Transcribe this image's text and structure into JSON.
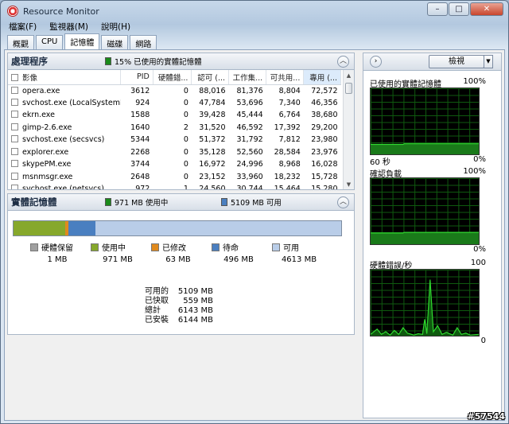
{
  "window": {
    "title": "Resource Monitor",
    "controls": [
      "–",
      "□",
      "✕"
    ]
  },
  "menu": [
    "檔案(F)",
    "監視器(M)",
    "說明(H)"
  ],
  "tabs": [
    {
      "label": "概觀",
      "active": false
    },
    {
      "label": "CPU",
      "active": false
    },
    {
      "label": "記憶體",
      "active": true
    },
    {
      "label": "磁碟",
      "active": false
    },
    {
      "label": "網路",
      "active": false
    }
  ],
  "processes": {
    "title": "處理程序",
    "summary": "15% 已使用的實體記憶體",
    "summary_color": "#1a8a1a",
    "columns": [
      "影像",
      "PID",
      "硬體錯...",
      "認可 (...",
      "工作集...",
      "可共用...",
      "專用 (..."
    ],
    "rows": [
      [
        "opera.exe",
        "3612",
        "0",
        "88,016",
        "81,376",
        "8,804",
        "72,572"
      ],
      [
        "svchost.exe (LocalSystemNe...",
        "924",
        "0",
        "47,784",
        "53,696",
        "7,340",
        "46,356"
      ],
      [
        "ekrn.exe",
        "1588",
        "0",
        "39,428",
        "45,444",
        "6,764",
        "38,680"
      ],
      [
        "gimp-2.6.exe",
        "1640",
        "2",
        "31,520",
        "46,592",
        "17,392",
        "29,200"
      ],
      [
        "svchost.exe (secsvcs)",
        "5344",
        "0",
        "51,372",
        "31,792",
        "7,812",
        "23,980"
      ],
      [
        "explorer.exe",
        "2268",
        "0",
        "35,128",
        "52,560",
        "28,584",
        "23,976"
      ],
      [
        "skypePM.exe",
        "3744",
        "0",
        "16,972",
        "24,996",
        "8,968",
        "16,028"
      ],
      [
        "msnmsgr.exe",
        "2648",
        "0",
        "23,152",
        "33,960",
        "18,232",
        "15,728"
      ],
      [
        "svchost.exe (netsvcs)",
        "972",
        "1",
        "24,560",
        "30,744",
        "15,464",
        "15,280"
      ]
    ]
  },
  "physical_memory": {
    "title": "實體記憶體",
    "in_use_summary": "971 MB 使用中",
    "available_summary": "5109 MB 可用",
    "segments": [
      {
        "label": "硬體保留",
        "value": "1 MB",
        "mb": 1,
        "color": "#a0a0a0"
      },
      {
        "label": "使用中",
        "value": "971 MB",
        "mb": 971,
        "color": "#86a82c"
      },
      {
        "label": "已修改",
        "value": "63 MB",
        "mb": 63,
        "color": "#e08a1e"
      },
      {
        "label": "待命",
        "value": "496 MB",
        "mb": 496,
        "color": "#4a7fc0"
      },
      {
        "label": "可用",
        "value": "4613 MB",
        "mb": 4613,
        "color": "#b9cde8"
      }
    ],
    "stats": [
      {
        "label": "可用的",
        "value": "5109 MB"
      },
      {
        "label": "已快取",
        "value": "559 MB"
      },
      {
        "label": "總計",
        "value": "6143 MB"
      },
      {
        "label": "已安裝",
        "value": "6144 MB"
      }
    ]
  },
  "graphs_panel": {
    "view_label": "檢視",
    "nav_icon": "chevron-right-icon",
    "graphs": [
      {
        "title": "已使用的實體記憶體",
        "max": "100%",
        "min": "0%",
        "time": "60 秒",
        "level_percent": 15
      },
      {
        "title": "確認負載",
        "max": "100%",
        "min": "0%",
        "time": "",
        "level_percent": 17
      },
      {
        "title": "硬體錯誤/秒",
        "max": "100",
        "min": "0",
        "time": "",
        "level_percent": 0
      }
    ]
  },
  "watermark": "#57544"
}
